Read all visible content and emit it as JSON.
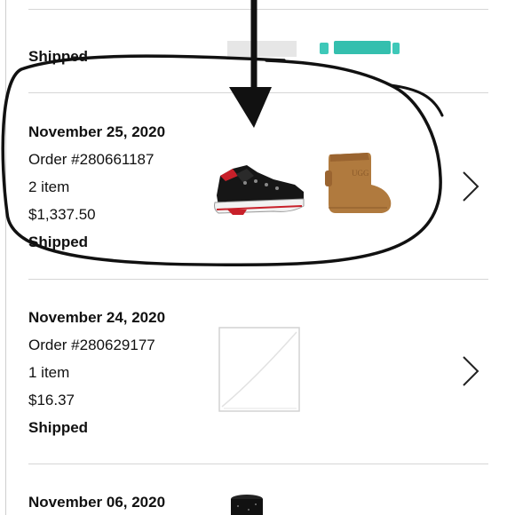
{
  "orders": [
    {
      "date": "",
      "order_number": "",
      "items": "",
      "total": "",
      "status": "Shipped"
    },
    {
      "date": "November 25, 2020",
      "order_number": "Order #280661187",
      "items": "2 item",
      "total": "$1,337.50",
      "status": "Shipped"
    },
    {
      "date": "November 24, 2020",
      "order_number": "Order #280629177",
      "items": "1 item",
      "total": "$16.37",
      "status": "Shipped"
    },
    {
      "date": "November 06, 2020"
    }
  ],
  "icons": {
    "chevron": "chevron-right-icon",
    "arrow": "down-arrow",
    "annotation": "hand-drawn-circle"
  },
  "colors": {
    "text": "#111111",
    "divider": "#d6d6d6",
    "teal_product": "#3ec8b8",
    "boot": "#b07a3e",
    "sneaker_sole_red": "#c8202a"
  }
}
